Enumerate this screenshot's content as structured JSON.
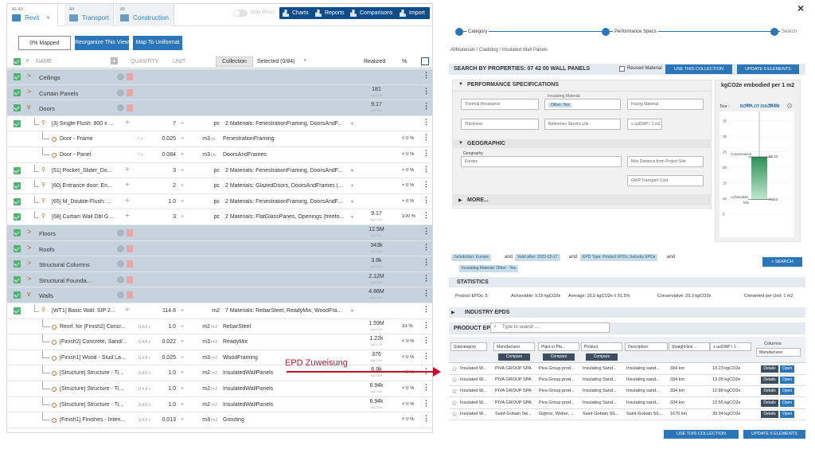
{
  "left": {
    "tabs": [
      {
        "small": "A1-A3",
        "label": "Revit"
      },
      {
        "small": "A4",
        "label": "Transport"
      },
      {
        "small": "A5",
        "label": "Construction"
      }
    ],
    "only_errors": "Only Errors",
    "top_buttons": [
      "Charts",
      "Reports",
      "Comparisons",
      "Import"
    ],
    "mapped": "0% Mapped",
    "reorganize": "Reorganize This View",
    "map_uniformat": "Map To Uniformat",
    "header": {
      "name": "NAME",
      "quantity": "QUANTITY",
      "unit": "UNIT",
      "collection": "Collection",
      "selected": "Selected (0/84)",
      "asterisk": "*",
      "realized": "Realized",
      "pct": "%"
    },
    "rows": [
      {
        "type": "grp",
        "name": "Ceilings",
        "chev": ">",
        "kg": "",
        "kgu": ""
      },
      {
        "type": "grp",
        "name": "Curtain Panels",
        "chev": ">",
        "kg": "181",
        "kgu": "kgCO2e"
      },
      {
        "type": "grp",
        "name": "Doors",
        "chev": "v",
        "kg": "9.17",
        "kgu": "kgCO2e"
      },
      {
        "type": "item",
        "cb": true,
        "name": "[3] Single-Flush: 800 x ...",
        "qty": "7",
        "unit": "pc",
        "coll": "2 Materials: FenestrationFraming, DoorsAndF...",
        "kg": "",
        "pct": ""
      },
      {
        "type": "sub",
        "name": "Door - Frame",
        "pre": "7 x",
        "qty": "0.025",
        "unit": "m3",
        "unit2": "/pc",
        "coll": "FenestrationFraming",
        "pct": "< 0 %"
      },
      {
        "type": "sub",
        "name": "Door - Panel",
        "pre": "7 x",
        "qty": "0.084",
        "unit": "m3",
        "unit2": "/pc",
        "coll": "DoorsAndFrames",
        "pct": "< 0 %"
      },
      {
        "type": "item",
        "cb": true,
        "name": "[51] Pocket_Slider_Do...",
        "qty": "3",
        "unit": "pc",
        "coll": "2 Materials: FenestrationFraming, DoorsAndF...",
        "pct": "≈ 0 %"
      },
      {
        "type": "item",
        "cb": true,
        "name": "[60] Entrance door: En...",
        "qty": "2",
        "unit": "pc",
        "coll": "2 Materials: GlazedDoors, DoorsAndFrames (...",
        "pct": "≈ 0 %"
      },
      {
        "type": "item",
        "cb": true,
        "name": "[65] M_Double-Flush: ...",
        "qty": "1.0",
        "unit": "pc",
        "coll": "2 Materials: FenestrationFraming, DoorsAndF...",
        "pct": "≈ 0 %"
      },
      {
        "type": "item",
        "cb": true,
        "name": "[68] Curtain Wall Dbl G...",
        "qty": "3",
        "unit": "pc",
        "coll": "2 Materials: FlatGlassPanes, Openings (freefo...",
        "kg": "9.17",
        "kgu": "kgCO2e",
        "pct": "100 %"
      },
      {
        "type": "grp",
        "name": "Floors",
        "chev": ">",
        "kg": "12.5M",
        "kgu": "kgCO2e"
      },
      {
        "type": "grp",
        "name": "Roofs",
        "chev": ">",
        "kg": "343k",
        "kgu": "kgCO2e"
      },
      {
        "type": "grp",
        "name": "Structural Columns",
        "chev": ">",
        "kg": "3.8k",
        "kgu": "kgCO2e"
      },
      {
        "type": "grp",
        "name": "Structural Founda...",
        "chev": ">",
        "kg": "2.12M",
        "kgu": "kgCO2e"
      },
      {
        "type": "grp",
        "name": "Walls",
        "chev": "v",
        "kg": "4.88M",
        "kgu": "kgCO2e"
      },
      {
        "type": "item",
        "cb": true,
        "name": "[WT1] Basic Wall: SIP 2...",
        "qty": "114.8",
        "unit": "m2",
        "coll": "7 Materials: RebarSteel, ReadyMix, WoodFra...",
        "pct": ""
      },
      {
        "type": "sub",
        "name": "Reinf. for [Finish2] Concr...",
        "pre": "114.8 x",
        "qty": "1.0",
        "unit": "m2",
        "unit2": "/m2",
        "coll": "RebarSteel",
        "kg": "1.59M",
        "kgu": "kgCO2e",
        "pct": "33 %"
      },
      {
        "type": "sub",
        "name": "[Finish2] Concrete, Sand/...",
        "pre": "114.8 x",
        "qty": "0.022",
        "unit": "m3",
        "unit2": "/m2",
        "coll": "ReadyMix",
        "kg": "1.22k",
        "kgu": "kgCO2e",
        "pct": "< 0 %"
      },
      {
        "type": "sub",
        "name": "[Finish1] Wood - Stud La...",
        "pre": "114.8 x",
        "qty": "0.025",
        "unit": "m3",
        "unit2": "/m2",
        "coll": "WoodFraming",
        "kg": "376",
        "kgu": "kgCO2e",
        "pct": "< 0 %"
      },
      {
        "type": "sub",
        "name": "[Structure] Structure - Ti...",
        "pre": "114.8 x",
        "qty": "1.0",
        "unit": "m2",
        "unit2": "/m2",
        "coll": "InsulatedWallPanels",
        "kg": "6.9k",
        "kgu": "kgCO2e",
        "pct": "< 0 %"
      },
      {
        "type": "sub",
        "name": "[Structure] Structure - Ti...",
        "pre": "114.8 x",
        "qty": "1.0",
        "unit": "m2",
        "unit2": "/m2",
        "coll": "InsulatedWallPanels",
        "kg": "6.94k",
        "kgu": "kgCO2e",
        "pct": "< 0 %"
      },
      {
        "type": "sub",
        "name": "[Structure] Structure - Ti...",
        "pre": "114.8 x",
        "qty": "1.0",
        "unit": "m2",
        "unit2": "/m2",
        "coll": "InsulatedWallPanels",
        "kg": "6.94k",
        "kgu": "kgCO2e",
        "pct": "< 0 %"
      },
      {
        "type": "sub",
        "name": "[Finish1] Finishes - Interi...",
        "pre": "114.8 x",
        "qty": "0.013",
        "unit": "m3",
        "unit2": "/m2",
        "coll": "Grouting",
        "kg": "",
        "kgu": "",
        "pct": "< 0 %"
      }
    ]
  },
  "annotation": "EPD Zuweisung",
  "right": {
    "steps": [
      "Category",
      "Performance Specs",
      "Search"
    ],
    "breadcrumb": "AllMaterials / Cladding / Insulated Wall Panels",
    "search_title": "SEARCH BY PROPERTIES: 07 42 00 WALL PANELS",
    "reused": "Reused Material",
    "use_collection": "USE THIS COLLECTION",
    "update": "UPDATE 6 ELEMENTS",
    "perf_title": "PERFORMANCE SPECIFICATIONS",
    "insulating_label": "Insulating Material",
    "fields": {
      "thermal": "Thermal Resistance",
      "other": "Other: Yes",
      "facing": "Facing Material",
      "thickness": "Thickness",
      "service_life": "Reference Service Life",
      "gwp": "≤ uuGWP / 1 m2"
    },
    "geo_title": "GEOGRAPHIC",
    "geo_label": "Geography",
    "europe": "Europe",
    "max_distance": "Max Distance from Project Site",
    "gwp_transport": "GWP Transport Cost",
    "more": "MORE...",
    "chart": {
      "title": "kgCO2e embodied per 1 m2",
      "tour": "Tour :",
      "boxplot": "BOXPLOT DIAGRAM",
      "max_label": "Max",
      "max_val": "39.94",
      "conservative": "Conservative",
      "cons_val": "23.33",
      "achievable": "Achievable",
      "min_label": "Min",
      "ach_val": "9.553",
      "ticks": [
        "35",
        "30",
        "25",
        "20",
        "15",
        "10",
        "5"
      ]
    },
    "filters": [
      "Jurisdiction: Europe",
      "and",
      "Valid after: 2022-02-17",
      "and",
      "EPD Type: Product EPDs, Industry EPDs",
      "and",
      "Insulating Material: Other - Yes"
    ],
    "search": "SEARCH",
    "stats_title": "STATISTICS",
    "stats": [
      "Product EPDs: 5",
      "Achievable: 9.55 kgCO2e",
      "Average: 16.5 kgCO2e ± 51.5%",
      "Conservative: 23.3 kgCO2e",
      "Converted per Unit: 1 m2"
    ],
    "industry": "INDUSTRY EPDS",
    "product_epds": "PRODUCT EPDS",
    "type_search": "Type to search ...",
    "table_headers": [
      "Subcategory",
      "Manufacturer",
      "Plant or Pla...",
      "Product",
      "Description",
      "Straight-line ...",
      "≤ uuGWP / 1 ...",
      "Columns"
    ],
    "compare": "Compare",
    "columns_select": "Manufacturer",
    "table_rows": [
      [
        "Insulated W...",
        "PIVA GROUP SPA",
        "Piva Group prod...",
        "Insulating Sand...",
        "Insulating sand...",
        "334 km",
        "13.23 kgCO2e"
      ],
      [
        "Insulated W...",
        "PIVA GROUP SPA",
        "Piva Group prod...",
        "Insulating Sand...",
        "Insulating sand...",
        "334 km",
        "13.05 kgCO2e"
      ],
      [
        "Insulated W...",
        "PIVA GROUP SPA",
        "Piva Group prod...",
        "Insulating Sand...",
        "Insulating sand...",
        "334 km",
        "12.88 kgCO2e"
      ],
      [
        "Insulated W...",
        "PIVA GROUP SPA",
        "Piva Group prod...",
        "Insulating Sand...",
        "Insulating sand...",
        "334 km",
        "13.55 kgCO2e"
      ],
      [
        "Insulated W...",
        "Saint-Gobain Sw...",
        "Gyproc, Weber, ...",
        "Saint-Gobain SIL...",
        "Saint-Gobain SIL...",
        "1670 km",
        "39.94 kgCO2e"
      ]
    ],
    "details": "Details",
    "open": "Open",
    "close": "×"
  }
}
